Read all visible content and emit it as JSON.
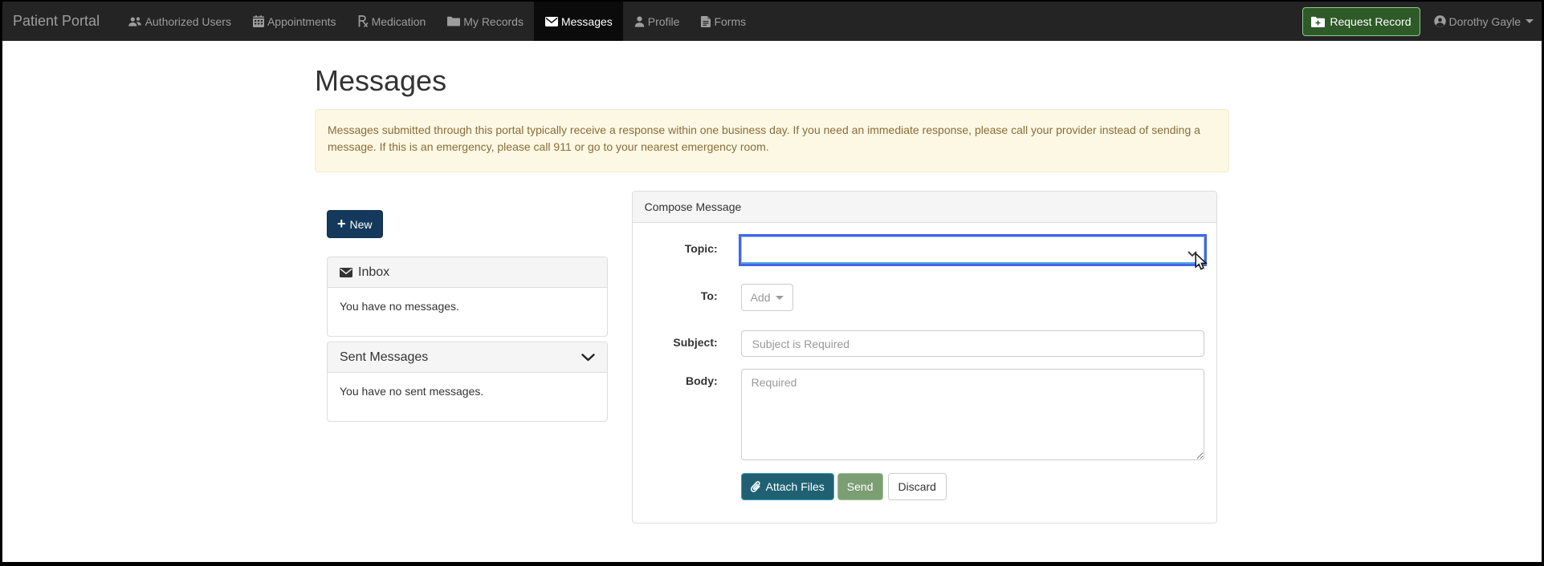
{
  "navbar": {
    "brand": "Patient Portal",
    "items": [
      {
        "label": "Authorized Users",
        "icon": "users-icon",
        "active": false
      },
      {
        "label": "Appointments",
        "icon": "calendar-icon",
        "active": false
      },
      {
        "label": "Medication",
        "icon": "rx-icon",
        "active": false
      },
      {
        "label": "My Records",
        "icon": "folder-icon",
        "active": false
      },
      {
        "label": "Messages",
        "icon": "envelope-icon",
        "active": true
      },
      {
        "label": "Profile",
        "icon": "user-icon",
        "active": false
      },
      {
        "label": "Forms",
        "icon": "file-icon",
        "active": false
      }
    ],
    "request_record_label": "Request Record",
    "user_name": "Dorothy Gayle"
  },
  "page": {
    "title": "Messages"
  },
  "alert": {
    "text": "Messages submitted through this portal typically receive a response within one business day. If you need an immediate response, please call your provider instead of sending a message. If this is an emergency, please call 911 or go to your nearest emergency room."
  },
  "sidebar": {
    "new_button_label": "New",
    "inbox": {
      "title": "Inbox",
      "empty_text": "You have no messages."
    },
    "sent": {
      "title": "Sent Messages",
      "empty_text": "You have no sent messages."
    }
  },
  "compose": {
    "title": "Compose Message",
    "topic_label": "Topic:",
    "topic_value": "",
    "to_label": "To:",
    "add_button_label": "Add",
    "subject_label": "Subject:",
    "subject_value": "",
    "subject_placeholder": "Subject is Required",
    "body_label": "Body:",
    "body_value": "",
    "body_placeholder": "Required",
    "attach_button_label": "Attach Files",
    "send_button_label": "Send",
    "discard_button_label": "Discard"
  },
  "colors": {
    "navbar_bg": "#242424",
    "navbar_active_bg": "#0b0b0b",
    "navbar_text": "#9d9d9d",
    "request_record_green": "#2d5a27",
    "new_button_navy": "#15395c",
    "attach_teal": "#1f6173",
    "send_green": "#7c9e73",
    "focus_ring_blue": "#4565e6",
    "alert_bg": "#fcf8e3",
    "alert_text": "#8a6d3b"
  }
}
